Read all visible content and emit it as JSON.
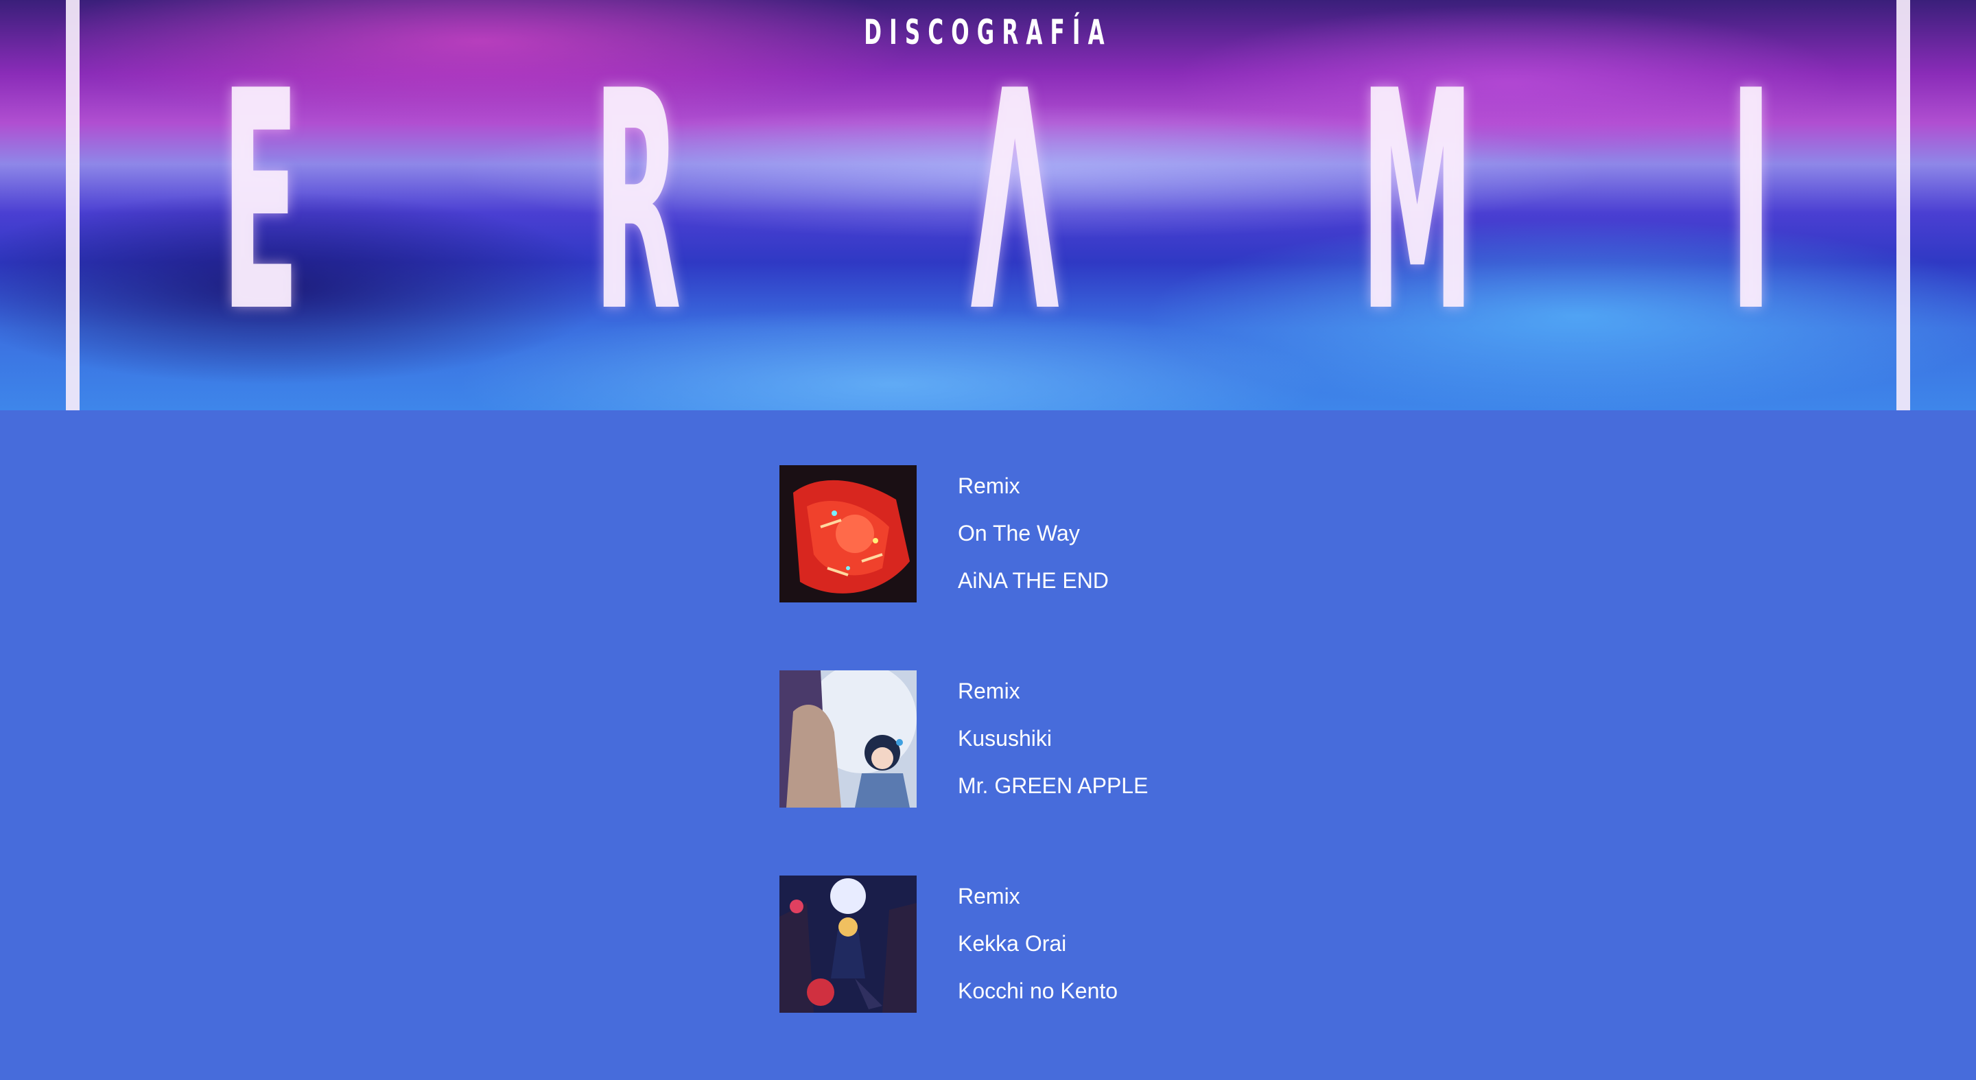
{
  "header": {
    "subtitle": "DISCOGRAFÍA",
    "title_letters": [
      "E",
      "R",
      "Λ",
      "M",
      "I"
    ]
  },
  "releases": [
    {
      "type": "Remix",
      "title": "On The Way",
      "artist": "AiNA THE END",
      "cover_icon": "album-cover-red-art"
    },
    {
      "type": "Remix",
      "title": "Kusushiki",
      "artist": "Mr. GREEN APPLE",
      "cover_icon": "album-cover-moon-portrait"
    },
    {
      "type": "Remix",
      "title": "Kekka Orai",
      "artist": "Kocchi no Kento",
      "cover_icon": "album-cover-night-scene"
    }
  ],
  "colors": {
    "background": "#476cdb",
    "text": "#ffffff"
  }
}
